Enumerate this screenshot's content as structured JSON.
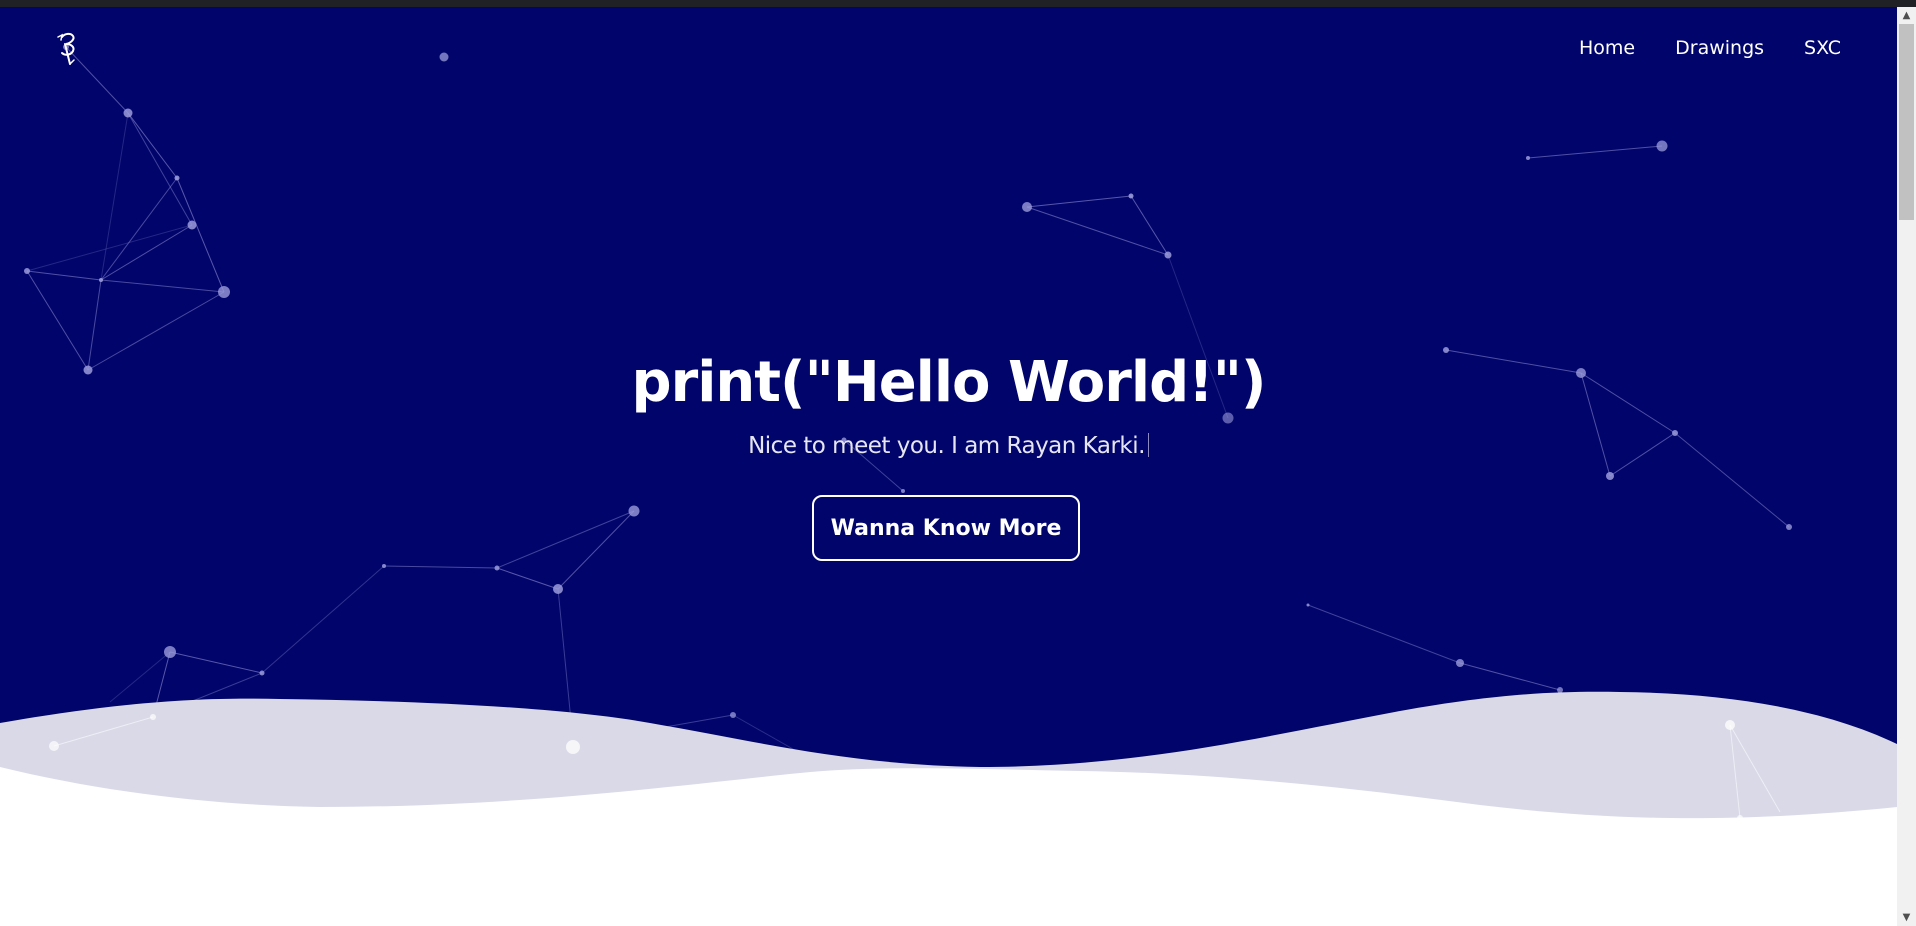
{
  "colors": {
    "hero_background": "#01046a",
    "wave_back": "#d9d9e8",
    "wave_front": "#ffffff",
    "text": "#ffffff"
  },
  "logo": {
    "icon": "stylized-signature-logo-icon"
  },
  "nav": {
    "items": [
      {
        "label": "Home"
      },
      {
        "label": "Drawings"
      },
      {
        "label": "SXC"
      }
    ]
  },
  "hero": {
    "title": "print(\"Hello World!\")",
    "subtitle": "Nice to meet you. I am Rayan Karki.",
    "cta_label": "Wanna Know More"
  }
}
